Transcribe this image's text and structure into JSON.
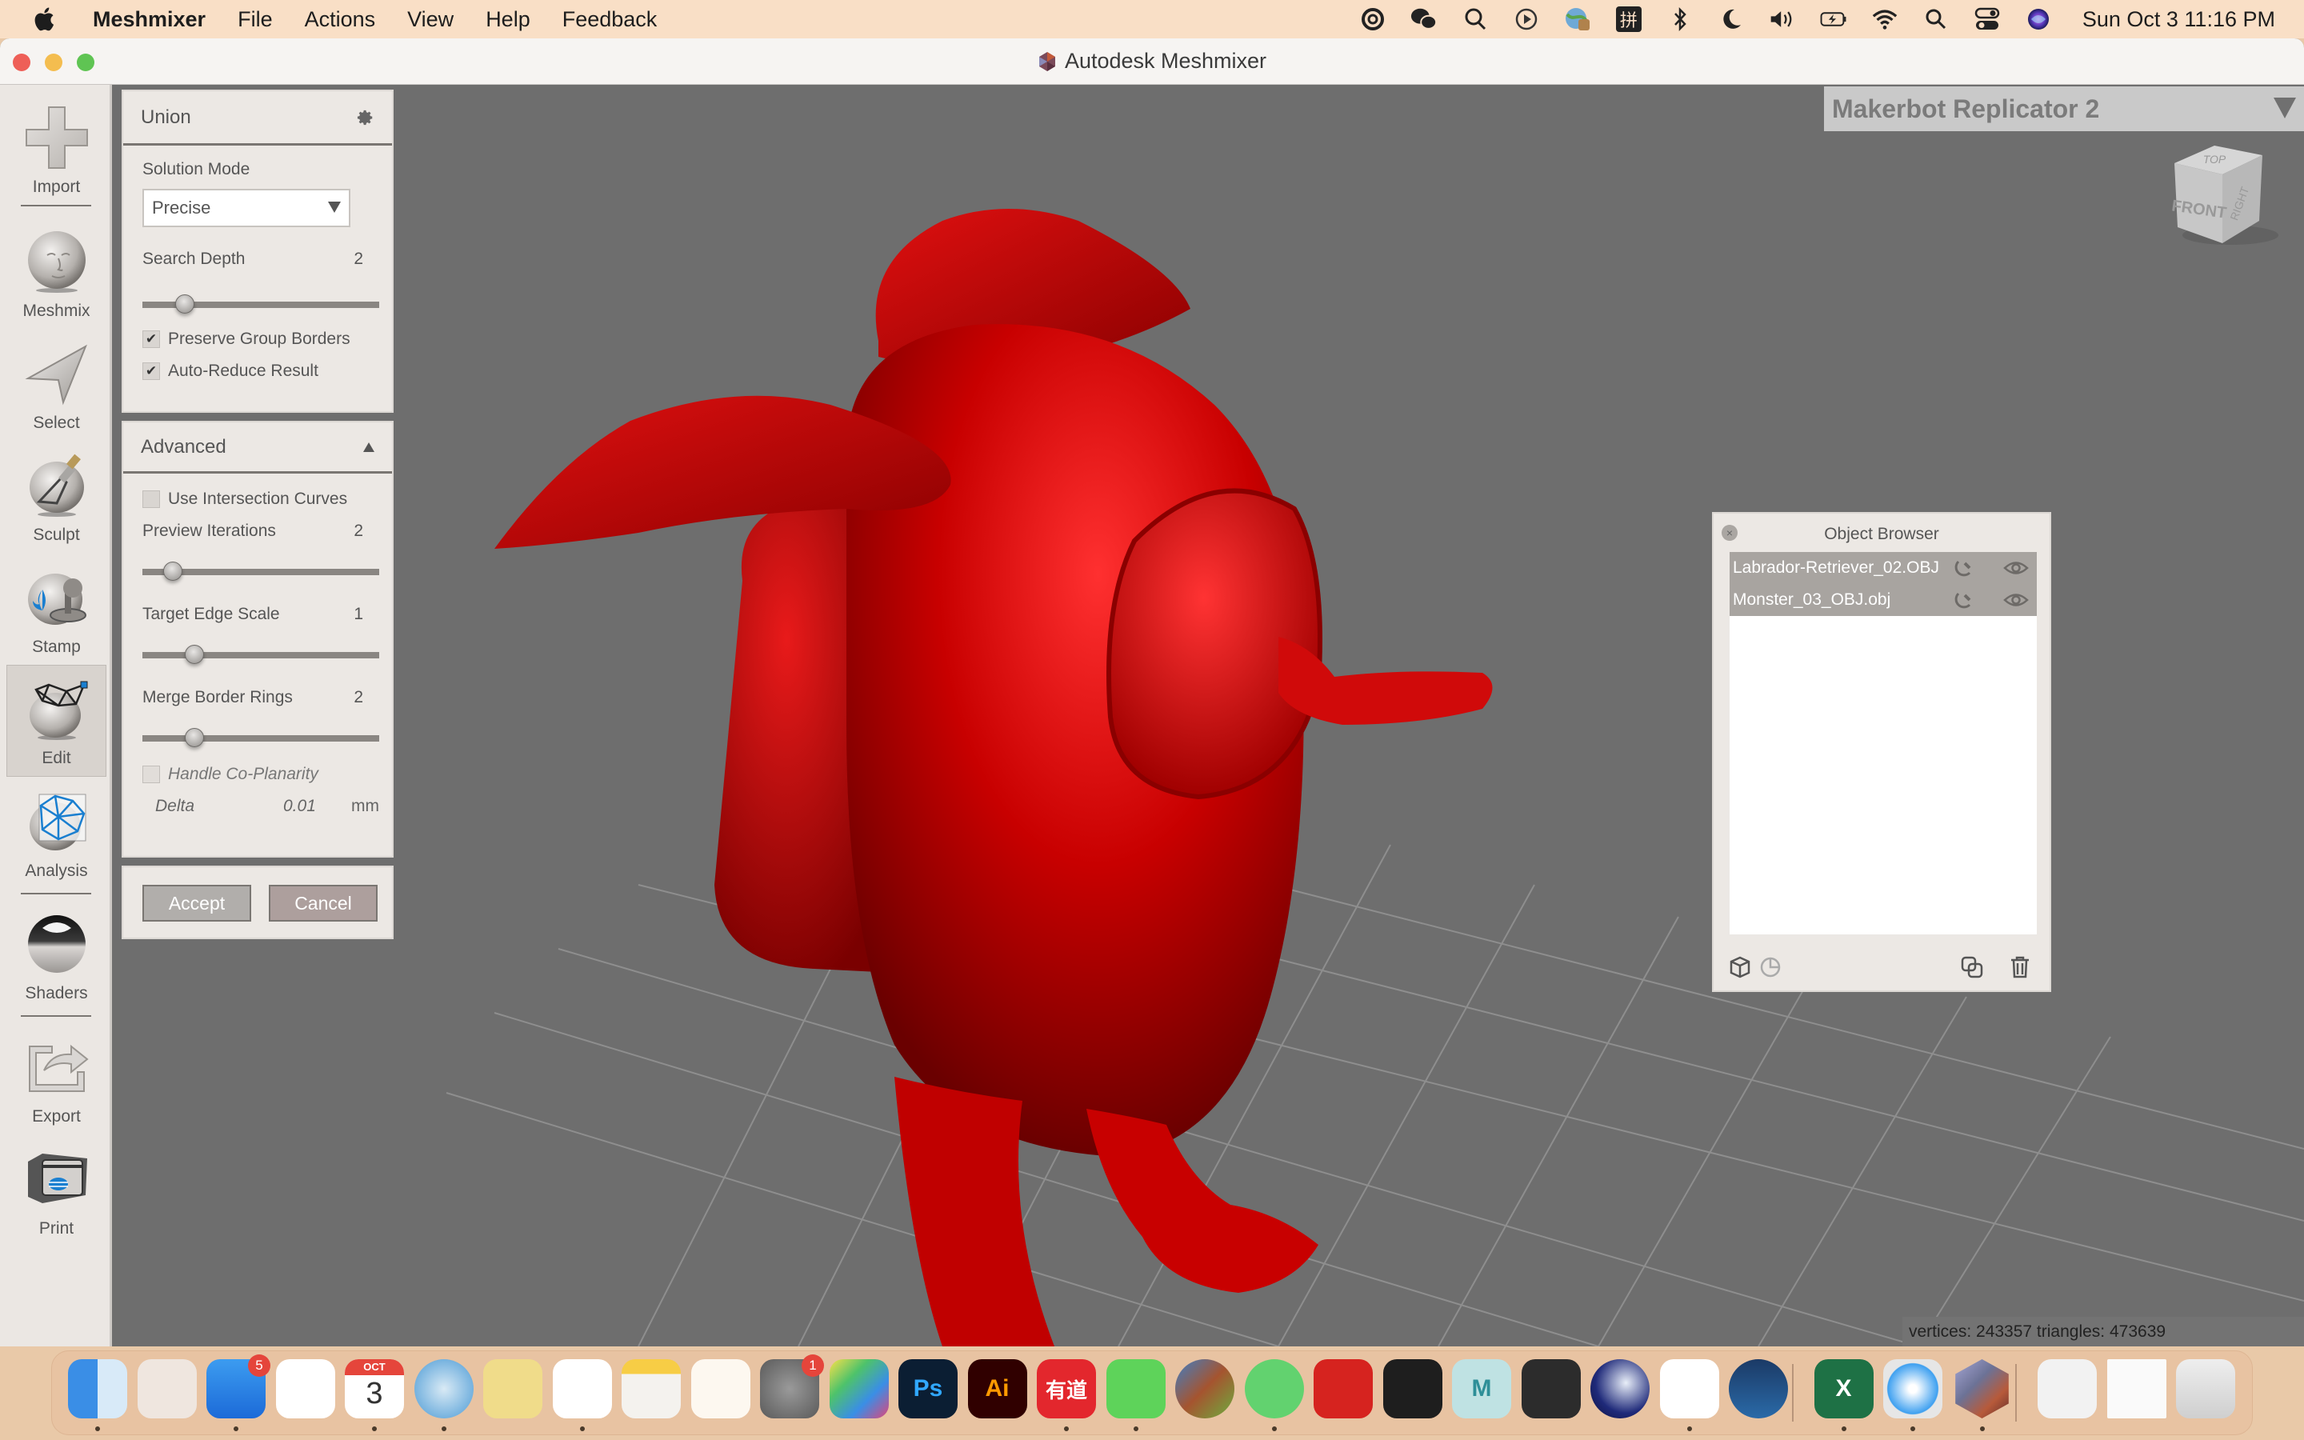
{
  "menubar": {
    "app_name": "Meshmixer",
    "items": [
      "File",
      "Actions",
      "View",
      "Help",
      "Feedback"
    ],
    "status_icons": [
      "creative-cloud-icon",
      "wechat-icon",
      "screenshot-icon",
      "play-icon",
      "vpn-icon",
      "input-method-icon",
      "bluetooth-icon",
      "do-not-disturb-icon",
      "volume-icon",
      "battery-icon",
      "wifi-icon",
      "spotlight-icon",
      "control-center-icon",
      "siri-icon"
    ],
    "input_method_glyph": "拼",
    "clock": "Sun Oct 3  11:16 PM"
  },
  "window": {
    "title": "Autodesk Meshmixer"
  },
  "toolbar": {
    "tools": [
      {
        "id": "import",
        "label": "Import"
      },
      {
        "id": "meshmix",
        "label": "Meshmix"
      },
      {
        "id": "select",
        "label": "Select"
      },
      {
        "id": "sculpt",
        "label": "Sculpt"
      },
      {
        "id": "stamp",
        "label": "Stamp"
      },
      {
        "id": "edit",
        "label": "Edit",
        "active": true
      },
      {
        "id": "analysis",
        "label": "Analysis"
      },
      {
        "id": "shaders",
        "label": "Shaders"
      },
      {
        "id": "export",
        "label": "Export"
      },
      {
        "id": "print",
        "label": "Print"
      }
    ]
  },
  "union_panel": {
    "title": "Union",
    "solution_mode_label": "Solution Mode",
    "solution_mode_value": "Precise",
    "search_depth_label": "Search Depth",
    "search_depth_value": "2",
    "search_depth_fraction": 0.18,
    "preserve_group_borders_label": "Preserve Group Borders",
    "preserve_group_borders": true,
    "auto_reduce_label": "Auto-Reduce Result",
    "auto_reduce": true
  },
  "advanced_panel": {
    "title": "Advanced",
    "use_intersection_curves_label": "Use Intersection Curves",
    "use_intersection_curves": false,
    "preview_iterations_label": "Preview Iterations",
    "preview_iterations_value": "2",
    "preview_iterations_fraction": 0.13,
    "target_edge_scale_label": "Target Edge Scale",
    "target_edge_scale_value": "1",
    "target_edge_scale_fraction": 0.22,
    "merge_border_rings_label": "Merge Border Rings",
    "merge_border_rings_value": "2",
    "merge_border_rings_fraction": 0.22,
    "handle_coplanarity_label": "Handle Co-Planarity",
    "handle_coplanarity": false,
    "delta_label": "Delta",
    "delta_value": "0.01",
    "delta_unit": "mm"
  },
  "actions": {
    "accept_label": "Accept",
    "cancel_label": "Cancel"
  },
  "viewport": {
    "printer": "Makerbot Replicator 2",
    "viewcube_faces": {
      "top": "TOP",
      "front": "FRONT",
      "right": "RIGHT"
    },
    "status": "vertices: 243357 triangles: 473639",
    "model_color": "#d40000",
    "background_color": "#6e6e6e"
  },
  "object_browser": {
    "title": "Object Browser",
    "objects": [
      {
        "name": "Labrador-Retriever_02.OBJ",
        "selected": true,
        "visible": true
      },
      {
        "name": "Monster_03_OBJ.obj",
        "selected": true,
        "visible": true
      }
    ]
  },
  "dock": {
    "apps": [
      {
        "name": "Finder",
        "running": true
      },
      {
        "name": "Launchpad",
        "running": false
      },
      {
        "name": "App Store",
        "running": true,
        "badge": "5"
      },
      {
        "name": "Google Chrome",
        "running": false
      },
      {
        "name": "Calendar",
        "running": true,
        "month": "OCT",
        "day": "3"
      },
      {
        "name": "VPN",
        "running": true
      },
      {
        "name": "Stickies",
        "running": false
      },
      {
        "name": "Reminders",
        "running": true
      },
      {
        "name": "Notes",
        "running": false
      },
      {
        "name": "Pages",
        "running": false
      },
      {
        "name": "System Preferences",
        "running": false,
        "badge": "1"
      },
      {
        "name": "Final Cut Pro",
        "running": false
      },
      {
        "name": "Photoshop",
        "running": false,
        "glyph": "Ps"
      },
      {
        "name": "Illustrator",
        "running": false,
        "glyph": "Ai"
      },
      {
        "name": "Youdao",
        "running": true,
        "glyph": "有道"
      },
      {
        "name": "WeChat",
        "running": true
      },
      {
        "name": "Sketchup",
        "running": false
      },
      {
        "name": "Spotify",
        "running": true
      },
      {
        "name": "NetEase Music",
        "running": false
      },
      {
        "name": "Figma",
        "running": false
      },
      {
        "name": "Maya",
        "running": false,
        "glyph": "M"
      },
      {
        "name": "Rhino",
        "running": false
      },
      {
        "name": "Cinema 4D",
        "running": false
      },
      {
        "name": "Slack",
        "running": true
      },
      {
        "name": "Steam",
        "running": false
      },
      {
        "name": "Microsoft Excel",
        "running": true,
        "glyph": "X"
      },
      {
        "name": "Safari",
        "running": true
      },
      {
        "name": "Meshmixer",
        "running": true
      },
      {
        "name": "Downloads",
        "running": false
      },
      {
        "name": "Recent Document",
        "running": false
      },
      {
        "name": "Trash",
        "running": false
      }
    ]
  }
}
